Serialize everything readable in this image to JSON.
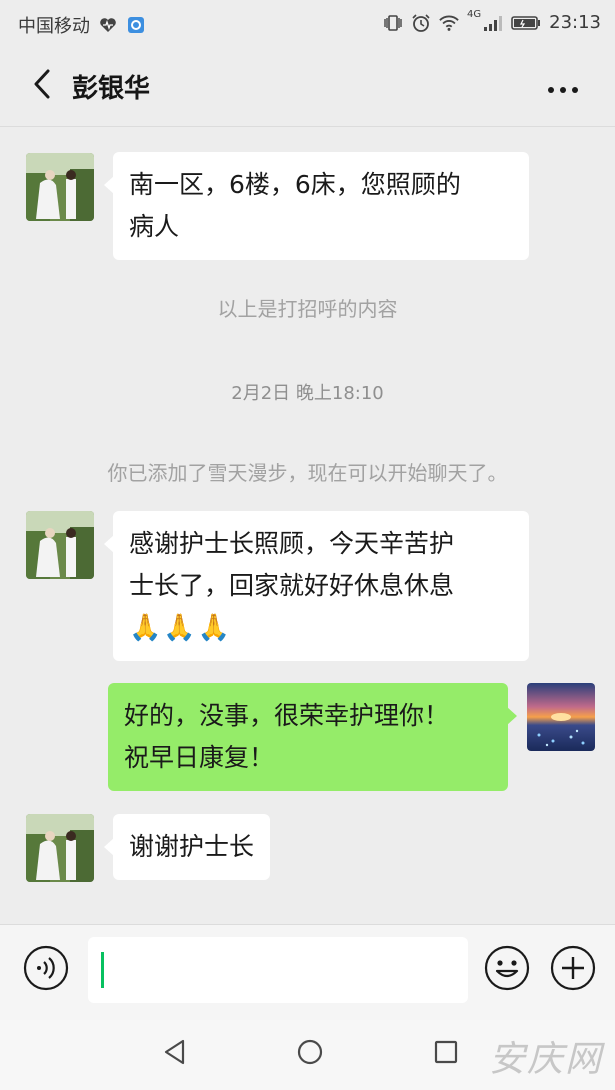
{
  "status_bar": {
    "carrier": "中国移动",
    "network": "4G",
    "time": "23:13"
  },
  "header": {
    "title": "彭银华",
    "back_icon": "chevron-left-icon",
    "more_icon": "more-dots-icon"
  },
  "messages": [
    {
      "side": "left",
      "text_lines": [
        "南一区，6楼，6床，您照顾的",
        "病人"
      ]
    },
    {
      "system": "以上是打招呼的内容"
    },
    {
      "timestamp": "2月2日 晚上18:10"
    },
    {
      "system": "你已添加了雪天漫步，现在可以开始聊天了。"
    },
    {
      "side": "left",
      "text_lines": [
        "感谢护士长照顾，今天辛苦护",
        "士长了，回家就好好休息休息"
      ],
      "emoji": "🙏🙏🙏"
    },
    {
      "side": "right",
      "text_lines": [
        "好的，没事，很荣幸护理你！",
        "祝早日康复！"
      ]
    },
    {
      "side": "left",
      "text_lines": [
        "谢谢护士长"
      ]
    }
  ],
  "input_bar": {
    "voice_icon": "voice-icon",
    "emoji_icon": "emoji-face-icon",
    "add_icon": "plus-circle-icon"
  },
  "nav_bar": {
    "back_icon": "triangle-back-icon",
    "home_icon": "circle-home-icon",
    "recent_icon": "square-recent-icon"
  },
  "watermark": "安庆网",
  "colors": {
    "chat_bg": "#ededed",
    "bubble_self": "#95ec69",
    "bubble_other": "#ffffff",
    "cursor": "#07c160"
  }
}
